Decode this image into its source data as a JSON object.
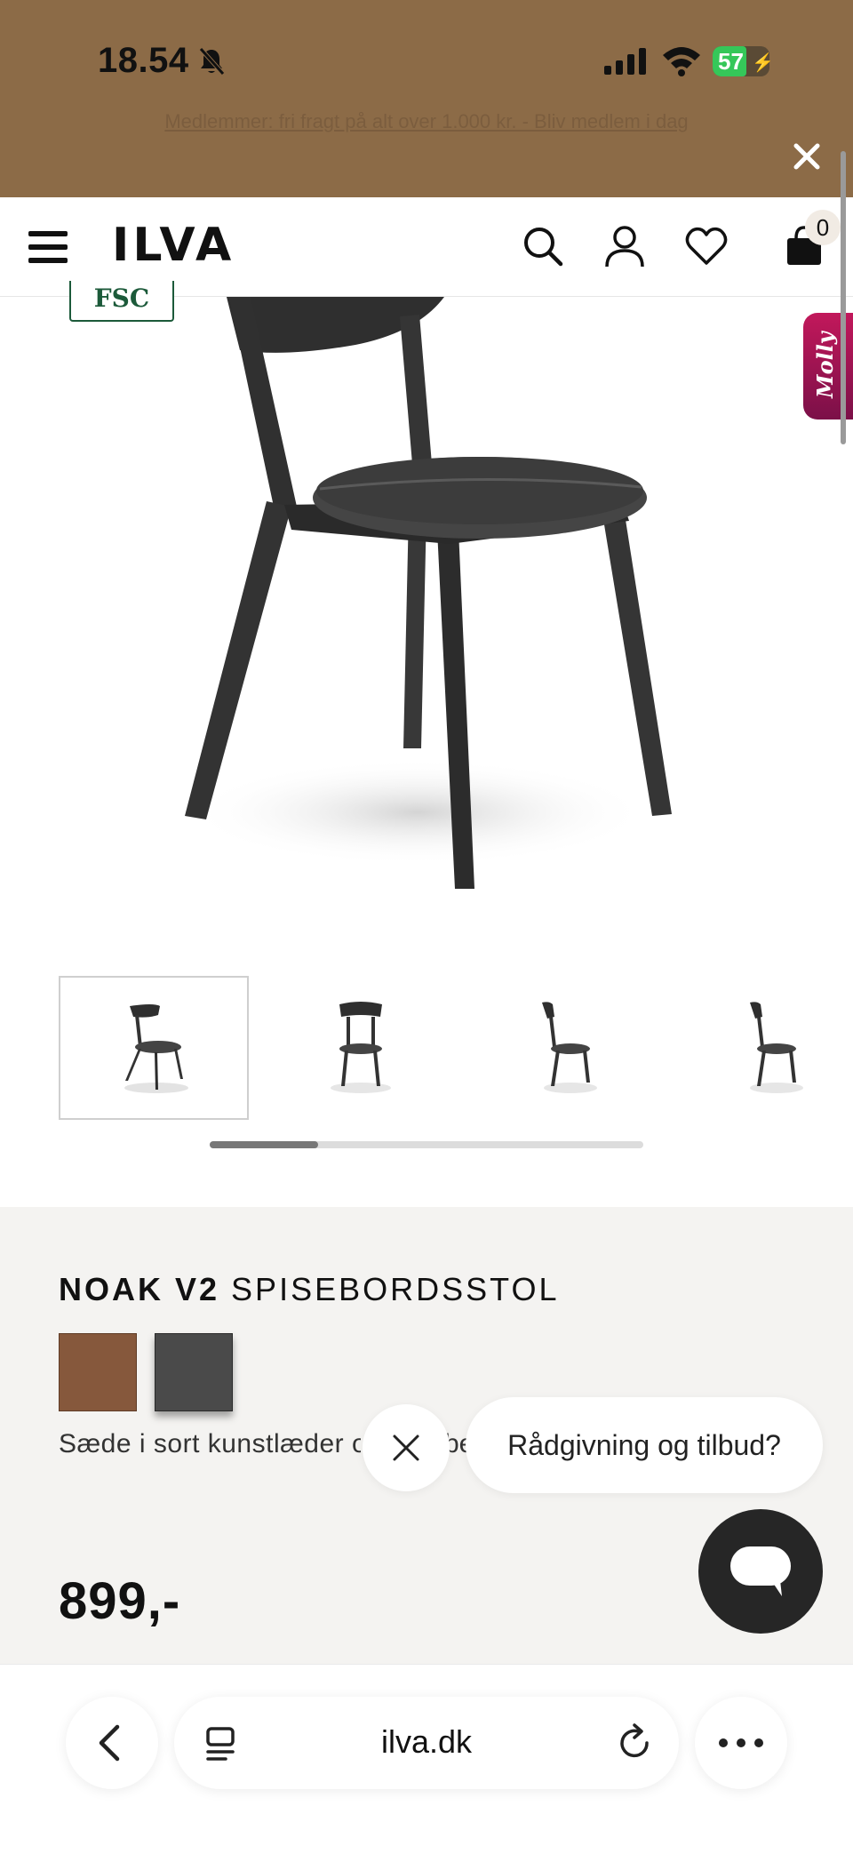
{
  "status_bar": {
    "time": "18.54",
    "battery": "57"
  },
  "banner": {
    "text": "Medlemmer: fri fragt på alt over 1.000 kr. - Bliv medlem i dag"
  },
  "header": {
    "logo": "ILVA",
    "cart_count": "0"
  },
  "badge": {
    "fsc": "FSC"
  },
  "chat_tab": {
    "label": "Molly"
  },
  "gallery": {
    "thumbnail_count": 4,
    "active_index": 0,
    "scroll_progress": 0.25
  },
  "product": {
    "name_bold": "NOAK V2",
    "name_rest": "SPISEBORDSSTOL",
    "description": "Sæde i sort kunstlæder og",
    "description_tail": "be",
    "price": "899,-",
    "swatches": [
      {
        "name": "brown",
        "color": "#86583c"
      },
      {
        "name": "dark grey",
        "color": "#4a4a4a"
      }
    ]
  },
  "chat": {
    "prompt": "Rådgivning og tilbud?"
  },
  "browser": {
    "url": "ilva.dk"
  },
  "colors": {
    "banner_bg": "#8c6b47",
    "info_bg": "#f4f3f1",
    "chat_fab": "#262626",
    "fsc_green": "#1c5a3a",
    "chat_tab_magenta": "#c2185b"
  }
}
